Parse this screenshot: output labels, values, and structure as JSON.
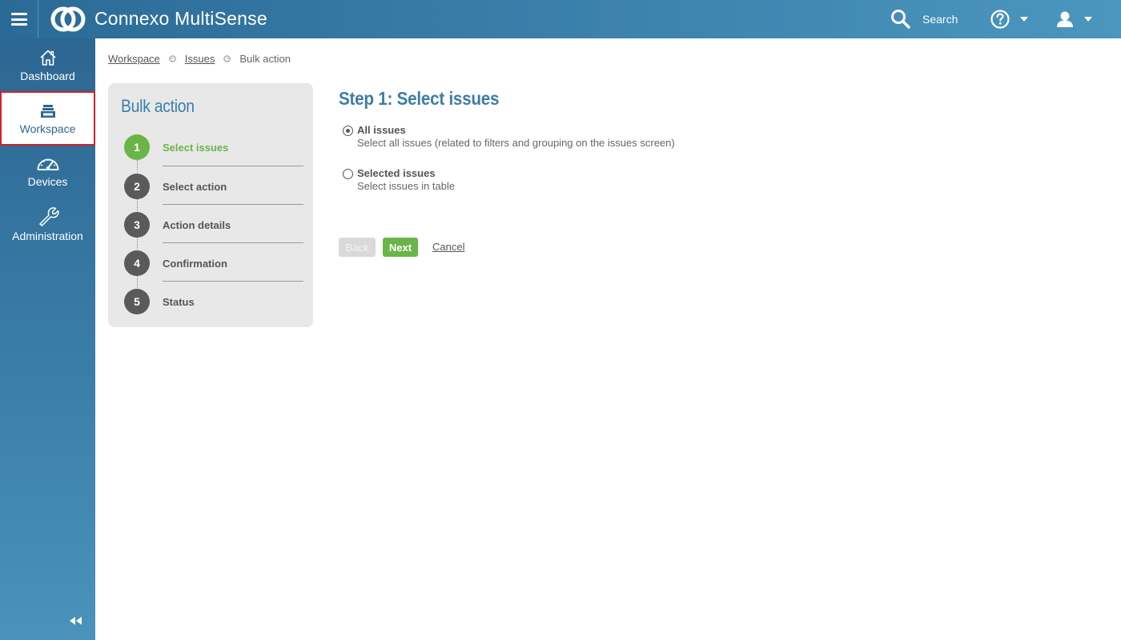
{
  "header": {
    "app_title": "Connexo MultiSense",
    "search_label": "Search"
  },
  "sidebar": {
    "items": [
      {
        "label": "Dashboard",
        "icon": "home-icon"
      },
      {
        "label": "Workspace",
        "icon": "workspace-tray-icon",
        "active": true
      },
      {
        "label": "Devices",
        "icon": "speedometer-icon"
      },
      {
        "label": "Administration",
        "icon": "wrench-icon"
      }
    ],
    "collapse_icon": "double-chevron-left-icon"
  },
  "breadcrumb": {
    "items": [
      "Workspace",
      "Issues"
    ],
    "current": "Bulk action"
  },
  "wizard": {
    "title": "Bulk action",
    "steps": [
      {
        "number": "1",
        "label": "Select issues",
        "current": true
      },
      {
        "number": "2",
        "label": "Select action"
      },
      {
        "number": "3",
        "label": "Action details"
      },
      {
        "number": "4",
        "label": "Confirmation"
      },
      {
        "number": "5",
        "label": "Status"
      }
    ]
  },
  "main": {
    "heading": "Step 1: Select issues",
    "options": [
      {
        "label": "All issues",
        "description": "Select all issues (related to filters and grouping on the issues screen)",
        "selected": true
      },
      {
        "label": "Selected issues",
        "description": "Select issues in table",
        "selected": false
      }
    ],
    "buttons": {
      "back": "Back",
      "next": "Next",
      "cancel": "Cancel"
    }
  },
  "colors": {
    "accent_blue": "#3d7ea4",
    "success_green": "#6ab547",
    "active_border": "#d3202a"
  }
}
